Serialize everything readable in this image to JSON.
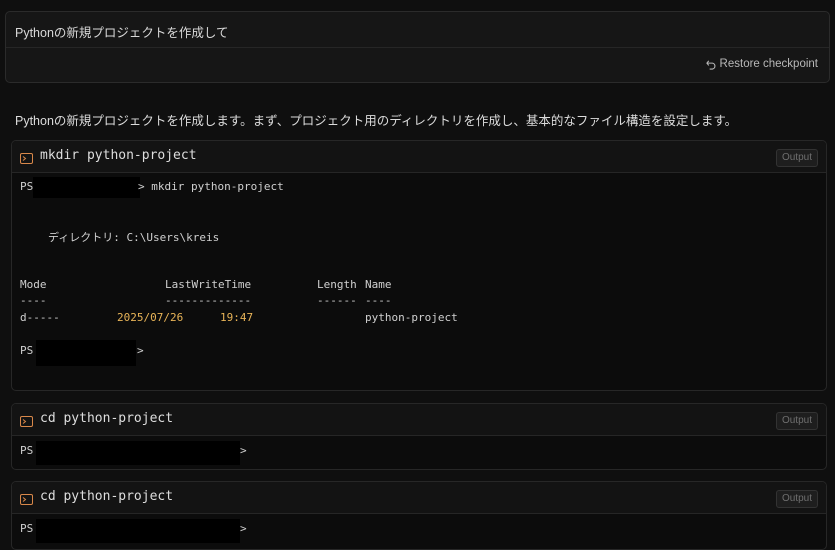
{
  "prompt": {
    "text": "Pythonの新規プロジェクトを作成して",
    "restore_label": "Restore checkpoint"
  },
  "assistant": {
    "message": "Pythonの新規プロジェクトを作成します。まず、プロジェクト用のディレクトリを作成し、基本的なファイル構造を設定します。"
  },
  "terminals": [
    {
      "command": "mkdir python-project",
      "output_label": "Output",
      "ps": "PS",
      "cmd_echo": "> mkdir python-project",
      "directory_line": "ディレクトリ: C:\\Users\\kreis",
      "columns": {
        "mode": "Mode",
        "lastwrite": "LastWriteTime",
        "length": "Length",
        "name": "Name"
      },
      "underlines": {
        "mode": "----",
        "lastwrite": "-------------",
        "length": "------",
        "name": "----"
      },
      "row": {
        "mode": "d-----",
        "date": "2025/07/26",
        "time": "19:47",
        "name": "python-project"
      },
      "prompt_end": ">"
    },
    {
      "command": "cd python-project",
      "output_label": "Output",
      "ps": "PS",
      "prompt_end": ">"
    },
    {
      "command": "cd python-project",
      "output_label": "Output",
      "ps": "PS",
      "prompt_end": ">"
    }
  ],
  "colors": {
    "background": "#0f0f0f",
    "terminal_icon": "#d9884a",
    "date_highlight": "#e8b458"
  },
  "icons": {
    "restore": "undo-arrow-icon",
    "terminal": "terminal-icon"
  }
}
